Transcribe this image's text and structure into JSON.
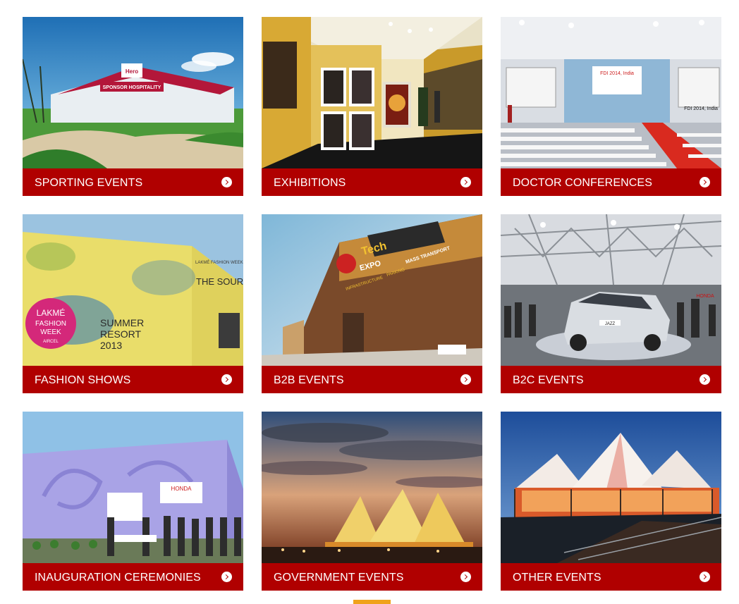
{
  "accent_color": "#b00000",
  "pager_color": "#f0a21a",
  "cards": [
    {
      "label": "SPORTING EVENTS",
      "icon": "chevron-right-circle-icon"
    },
    {
      "label": "EXHIBITIONS",
      "icon": "chevron-right-circle-icon"
    },
    {
      "label": "DOCTOR CONFERENCES",
      "icon": "chevron-right-circle-icon"
    },
    {
      "label": "FASHION SHOWS",
      "icon": "chevron-right-circle-icon"
    },
    {
      "label": "B2B EVENTS",
      "icon": "chevron-right-circle-icon"
    },
    {
      "label": "B2C EVENTS",
      "icon": "chevron-right-circle-icon"
    },
    {
      "label": "INAUGURATION CEREMONIES",
      "icon": "chevron-right-circle-icon"
    },
    {
      "label": "GOVERNMENT EVENTS",
      "icon": "chevron-right-circle-icon"
    },
    {
      "label": "OTHER EVENTS",
      "icon": "chevron-right-circle-icon"
    }
  ],
  "photo_text": {
    "sporting_tent_sign": "SPONSOR HOSPITALITY",
    "sporting_logo": "Hero",
    "conference_banner": "FDI 2014, India",
    "conference_side": "FDI 2014, India",
    "fashion_brand": "LAKMÉ",
    "fashion_line1": "FASHION",
    "fashion_line2": "WEEK",
    "fashion_sponsor": "AIRCEL",
    "fashion_title": "THE SOURCE",
    "fashion_brand_top": "LAKMÉ FASHION WEEK",
    "fashion_summer1": "SUMMER",
    "fashion_summer2": "RESORT",
    "fashion_summer3": "2013",
    "b2b_tech": "Tech",
    "b2b_expo": "EXPO",
    "b2b_mass": "MASS TRANSPORT",
    "b2b_parking": "PARKING",
    "b2b_infra": "INFRASTRUCTURE",
    "b2c_car": "JAZZ",
    "b2c_honda": "HONDA",
    "inaug_honda": "HONDA"
  }
}
